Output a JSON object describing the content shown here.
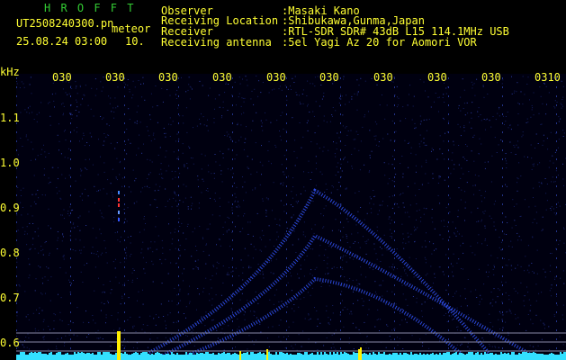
{
  "header": {
    "app_name": "H R O F F T",
    "file_name": "UT2508240300.pn",
    "detection_type": "meteor",
    "datetime": "25.08.24 03:00",
    "count": "10.",
    "observer_label": "Observer",
    "observer_value": ":Masaki Kano",
    "location_label": "Receiving Location",
    "location_value": ":Shibukawa,Gunma,Japan",
    "receiver_label": "Receiver",
    "receiver_value": ":RTL-SDR SDR# 43dB L15 114.1MHz USB",
    "antenna_label": "Receiving antenna",
    "antenna_value": ":5el Yagi Az 20 for Aomori VOR"
  },
  "spectrogram": {
    "y_unit": "kHz",
    "y_ticks": [
      "1.1",
      "1.0",
      "0.9",
      "0.8",
      "0.7",
      "0.6"
    ],
    "x_ticks": [
      "030",
      "030",
      "030",
      "030",
      "030",
      "030",
      "030",
      "030",
      "030",
      "0310"
    ],
    "colors": {
      "background": "#000010",
      "text": "#ffff33",
      "title": "#33cc33",
      "trace": "#3355ff",
      "baseline": "#33e0ff"
    }
  }
}
